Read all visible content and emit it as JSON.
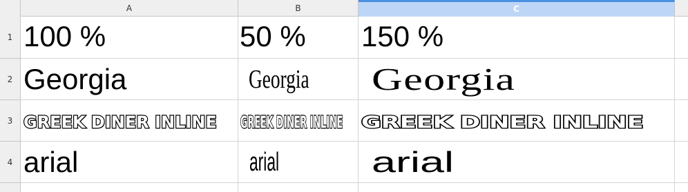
{
  "columns": [
    {
      "label": "A",
      "selected": false
    },
    {
      "label": "B",
      "selected": false
    },
    {
      "label": "C",
      "selected": true
    }
  ],
  "rows": [
    {
      "label": "1",
      "cells": [
        "100 %",
        "50 %",
        "150 %"
      ]
    },
    {
      "label": "2",
      "cells": [
        "Georgia",
        "Georgia",
        "Georgia"
      ]
    },
    {
      "label": "3",
      "cells": [
        "GREEK DINER INLINE",
        "GREEK DINER INLINE",
        "GREEK DINER INLINE"
      ]
    },
    {
      "label": "4",
      "cells": [
        "arial",
        "arial",
        "arial"
      ]
    }
  ],
  "colors": {
    "header_bg": "#efefef",
    "grid": "#d4d4d4",
    "selected_header_bg": "#bdd6f7",
    "selected_header_accent": "#4a90e2"
  }
}
